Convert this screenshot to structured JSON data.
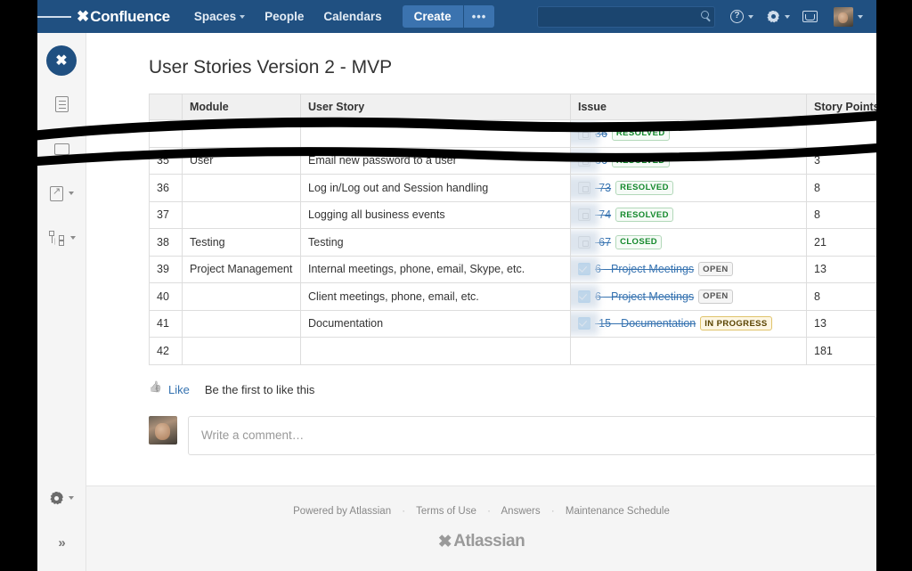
{
  "navbar": {
    "menu_icon": "hamburger-icon",
    "brand": "Confluence",
    "items": [
      {
        "label": "Spaces",
        "has_caret": true
      },
      {
        "label": "People",
        "has_caret": false
      },
      {
        "label": "Calendars",
        "has_caret": false
      }
    ],
    "create_label": "Create",
    "create_more_label": "•••",
    "search_placeholder": "",
    "help_glyph": "?",
    "icons": [
      "search-icon",
      "help-icon",
      "settings-gear-icon",
      "notifications-inbox-icon",
      "user-avatar"
    ]
  },
  "sidebar": {
    "space_logo_glyph": "✖",
    "items": [
      {
        "name": "pages-icon",
        "caret": false
      },
      {
        "name": "mail-icon",
        "caret": false
      },
      {
        "name": "shortcut-icon",
        "caret": true
      },
      {
        "name": "page-tree-icon",
        "caret": true
      }
    ],
    "settings_caret": true,
    "expand_glyph": "»"
  },
  "main": {
    "page_title": "User Stories Version 2 - MVP",
    "table": {
      "columns": [
        "",
        "Module",
        "User Story",
        "Issue",
        "Story Points"
      ],
      "rows": [
        {
          "num": "",
          "module": "",
          "story": "",
          "issue": {
            "icon": "jira-issue-icon",
            "key": "36",
            "status": "RESOLVED",
            "status_type": "resolved"
          },
          "points": "",
          "obscured": true
        },
        {
          "num": "35",
          "module": "User",
          "story": "Email new password to a user",
          "issue": {
            "icon": "jira-issue-icon",
            "key": "36",
            "status": "RESOLVED",
            "status_type": "resolved"
          },
          "points": "3",
          "obscured": false
        },
        {
          "num": "36",
          "module": "",
          "story": "Log in/Log out and Session handling",
          "issue": {
            "icon": "jira-issue-icon",
            "key": "-73",
            "status": "RESOLVED",
            "status_type": "resolved"
          },
          "points": "8",
          "obscured": false
        },
        {
          "num": "37",
          "module": "",
          "story": "Logging all business events",
          "issue": {
            "icon": "jira-issue-icon",
            "key": "-74",
            "status": "RESOLVED",
            "status_type": "resolved"
          },
          "points": "8",
          "obscured": false
        },
        {
          "num": "38",
          "module": "Testing",
          "story": "Testing",
          "issue": {
            "icon": "jira-issue-icon",
            "key": "-67",
            "status": "CLOSED",
            "status_type": "closed"
          },
          "points": "21",
          "obscured": false
        },
        {
          "num": "39",
          "module": "Project Management",
          "story": "Internal meetings, phone, email, Skype, etc.",
          "issue": {
            "icon": "jira-task-checkbox-icon",
            "key": "6 - Project Meetings",
            "status": "OPEN",
            "status_type": "open"
          },
          "points": "13",
          "obscured": false
        },
        {
          "num": "40",
          "module": "",
          "story": "Client meetings, phone, email, etc.",
          "issue": {
            "icon": "jira-task-checkbox-icon",
            "key": "6 - Project Meetings",
            "status": "OPEN",
            "status_type": "open"
          },
          "points": "8",
          "obscured": false
        },
        {
          "num": "41",
          "module": "",
          "story": "Documentation",
          "issue": {
            "icon": "jira-task-checkbox-icon",
            "key": "-15 - Documentation",
            "status": "IN PROGRESS",
            "status_type": "progress"
          },
          "points": "13",
          "obscured": false
        },
        {
          "num": "42",
          "module": "",
          "story": "",
          "issue": null,
          "points": "181",
          "obscured": false
        }
      ]
    },
    "like": {
      "label": "Like",
      "note": "Be the first to like this"
    },
    "comment_placeholder": "Write a comment…"
  },
  "footer": {
    "links": [
      "Powered by Atlassian",
      "Terms of Use",
      "Answers",
      "Maintenance Schedule"
    ],
    "separator": "·",
    "logo_text": "Atlassian"
  },
  "colors": {
    "nav_blue": "#205081",
    "link_blue": "#3572b0",
    "resolved_green": "#14892c",
    "in_progress_amber": "#594300",
    "task_blue": "#3b9ae1"
  }
}
